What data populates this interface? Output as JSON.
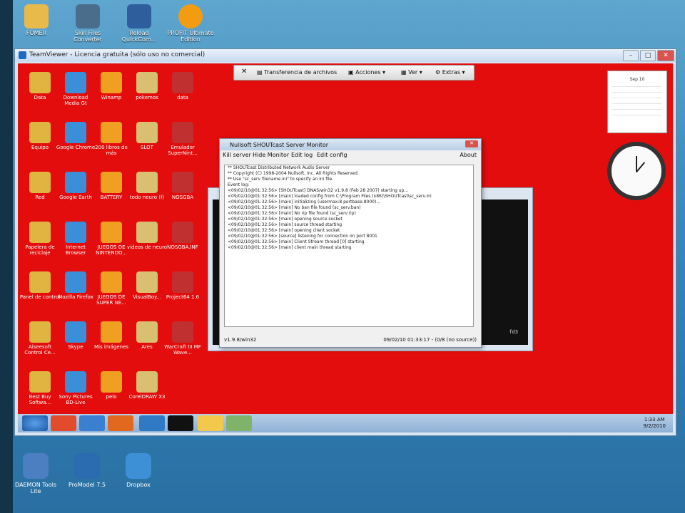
{
  "top_desktop_icons": [
    {
      "label": "FOMER",
      "color": "#e8b94b"
    },
    {
      "label": "Skill Files Converter",
      "color": "#4a6d8c"
    },
    {
      "label": "Reload QuickCom...",
      "color": "#2e5e9e"
    },
    {
      "label": "PROFIT Ultimate Edition",
      "color": "#f39c12"
    }
  ],
  "tv_window": {
    "title": "TeamViewer - Licencia gratuita (sólo uso no comercial)",
    "toolbar": {
      "close": "✕",
      "transfer": "Transferencia de archivos",
      "actions": "Acciones",
      "view": "Ver",
      "extras": "Extras"
    }
  },
  "remote_icons": [
    [
      "Data",
      "Download Media Gt",
      "Winamp",
      "pokemos",
      "data"
    ],
    [
      "Equipo",
      "Google Chrome",
      "200 libros de más",
      "SLOT",
      "Emulador SuperNint..."
    ],
    [
      "Red",
      "Google Earth",
      "BATTERY",
      "todo neuro (f)",
      "NOSGBA"
    ],
    [
      "Papelera de reciclaje",
      "Internet Browser",
      "JUEGOS DE NINTENDO...",
      "videos de neuro",
      "NOSGBA.INF"
    ],
    [
      "Panel de control",
      "Mozilla Firefox",
      "JUEGOS DE SUPER NE...",
      "VisualBoy...",
      "Project64 1.6"
    ],
    [
      "Aiseesoft Control Ce...",
      "Skype",
      "Mis imágenes",
      "Ares",
      "WarCraft III MF Wave..."
    ],
    [
      "Best Buy Softwa...",
      "Sony Pictures BD-Live",
      "pelo",
      "CorelDRAW X3",
      ""
    ]
  ],
  "shout": {
    "title": "Nullsoft SHOUTcast Server Monitor",
    "menu": [
      "Kill server",
      "Hide Monitor",
      "Edit log",
      "Edit config",
      "About"
    ],
    "lines": [
      "** SHOUTcast Distributed Network Audio Server",
      "** Copyright (C) 1998-2004 Nullsoft, Inc.  All Rights Reserved.",
      "** Use \"sc_serv filename.ini\" to specify an ini file.",
      "",
      "Event log:",
      "<09/02/10@01:32:56> [SHOUTcast] DNAS/win32 v1.9.8 (Feb 28 2007) starting up...",
      "<09/02/10@01:32:56> [main] loaded config from C:\\Program Files (x86)\\SHOUTcast\\sc_serv.ini",
      "<09/02/10@01:32:56> [main] initializing (usermax:8 portbase:8000)...",
      "<09/02/10@01:32:56> [main] No ban file found (sc_serv.ban)",
      "<09/02/10@01:32:56> [main] No rip file found (sc_serv.rip)",
      "<09/02/10@01:32:56> [main] opening source socket",
      "<09/02/10@01:32:56> [main] source thread starting",
      "<09/02/10@01:32:56> [main] opening client socket",
      "<09/02/10@01:32:56> [source] listening for connection on port 8001",
      "<09/02/10@01:32:56> [main] Client Stream thread [0] starting",
      "<09/02/10@01:32:56> [main] client main thread starting"
    ],
    "status_left": "v1.9.8/win32",
    "status_right": "09/02/10 01:33:17 - (0/8 (no source))"
  },
  "console_text": "fd3",
  "calendar": {
    "month": "Sep 10"
  },
  "tray": {
    "time": "1:33 AM",
    "date": "9/2/2010"
  },
  "bottom_icons": [
    {
      "label": "DAEMON Tools Lite",
      "color": "#4b7fc2"
    },
    {
      "label": "ProModel 7.5",
      "color": "#2b6cb0"
    },
    {
      "label": "Dropbox",
      "color": "#3d8fd6"
    }
  ]
}
